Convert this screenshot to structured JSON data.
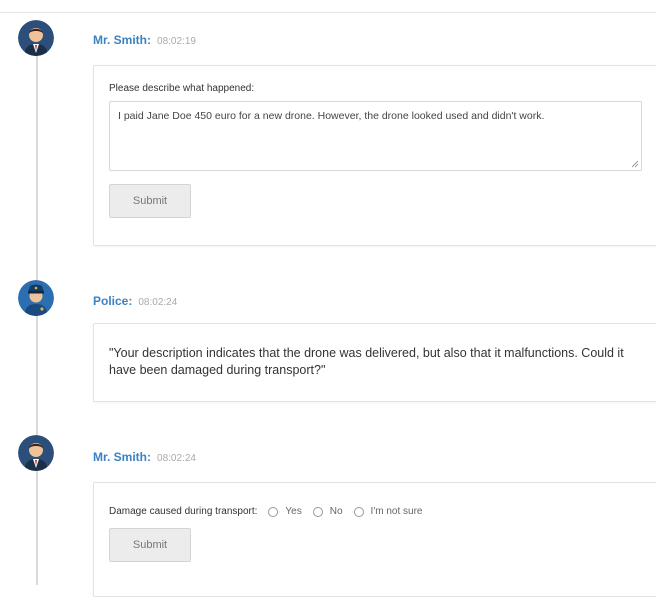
{
  "messages": [
    {
      "sender": "Mr. Smith:",
      "time": "08:02:19",
      "avatar": "man-avatar-icon",
      "form": {
        "label": "Please describe what happened:",
        "textarea_value": "I paid Jane Doe 450 euro for a new drone. However, the drone looked used and didn't work.",
        "submit_label": "Submit"
      }
    },
    {
      "sender": "Police:",
      "time": "08:02:24",
      "avatar": "police-officer-avatar-icon",
      "quote": "\"Your description indicates that the drone was delivered, but also that it malfunctions. Could it have been damaged during transport?\""
    },
    {
      "sender": "Mr. Smith:",
      "time": "08:02:24",
      "avatar": "man-avatar-icon",
      "form": {
        "label": "Damage caused during transport:",
        "options": [
          "Yes",
          "No",
          "I'm not sure"
        ],
        "submit_label": "Submit"
      }
    }
  ],
  "colors": {
    "sender_name": "#3b82c4",
    "timestamp": "#aaaaaa",
    "timeline": "#d9d9d9",
    "button_bg": "#ececec"
  }
}
